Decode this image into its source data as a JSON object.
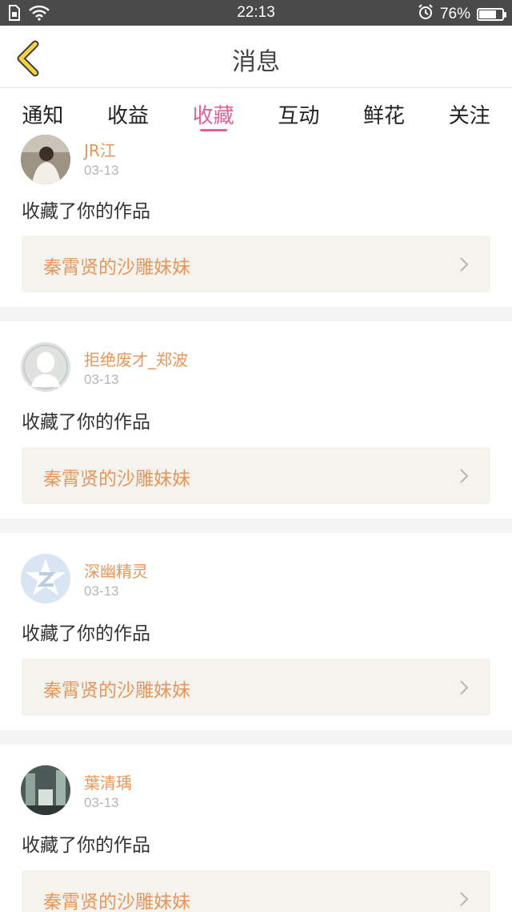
{
  "status_bar": {
    "time": "22:13",
    "battery_text": "76%",
    "battery_level": 0.76,
    "icons": [
      "sim-icon",
      "wifi-icon",
      "alarm-icon",
      "battery-icon"
    ]
  },
  "nav": {
    "title": "消息",
    "back_icon": "chevron-left-icon"
  },
  "tabs": [
    {
      "label": "通知",
      "active": false
    },
    {
      "label": "收益",
      "active": false
    },
    {
      "label": "收藏",
      "active": true
    },
    {
      "label": "互动",
      "active": false
    },
    {
      "label": "鲜花",
      "active": false
    },
    {
      "label": "关注",
      "active": false
    }
  ],
  "colors": {
    "accent": "#e3609a",
    "username": "#e8965a",
    "date": "#b5b5b5",
    "link_bg": "#f4f3ee",
    "status_bar": "#4a4a4a"
  },
  "items": [
    {
      "username": "JR江",
      "date": "03-13",
      "action": "收藏了你的作品",
      "work_title": "秦霄贤的沙雕妹妹"
    },
    {
      "username": "拒绝废才_郑波",
      "date": "03-13",
      "action": "收藏了你的作品",
      "work_title": "秦霄贤的沙雕妹妹"
    },
    {
      "username": "深幽精灵",
      "date": "03-13",
      "action": "收藏了你的作品",
      "work_title": "秦霄贤的沙雕妹妹"
    },
    {
      "username": "葉清瑀",
      "date": "03-13",
      "action": "收藏了你的作品",
      "work_title": "秦霄贤的沙雕妹妹"
    }
  ]
}
